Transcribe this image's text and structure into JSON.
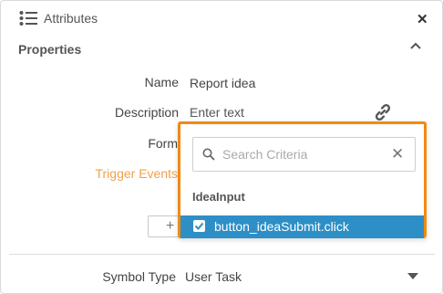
{
  "header": {
    "title": "Attributes",
    "icon": "list-icon",
    "close_icon": "close-icon"
  },
  "properties": {
    "title": "Properties",
    "fields": {
      "name": {
        "label": "Name",
        "value": "Report idea"
      },
      "description": {
        "label": "Description",
        "placeholder": "Enter text"
      },
      "form": {
        "label": "Form"
      },
      "trigger_events": {
        "label": "Trigger Events"
      }
    },
    "add_button_icon": "plus-icon"
  },
  "symbol_type": {
    "label": "Symbol Type",
    "value": "User Task"
  },
  "dropdown": {
    "search_placeholder": "Search Criteria",
    "group": "IdeaInput",
    "options": [
      {
        "label": "button_ideaSubmit.click",
        "checked": true
      }
    ]
  },
  "colors": {
    "accent": "#f08a12",
    "selected_row": "#2d8fc6",
    "trigger_label": "#f0a14a"
  }
}
